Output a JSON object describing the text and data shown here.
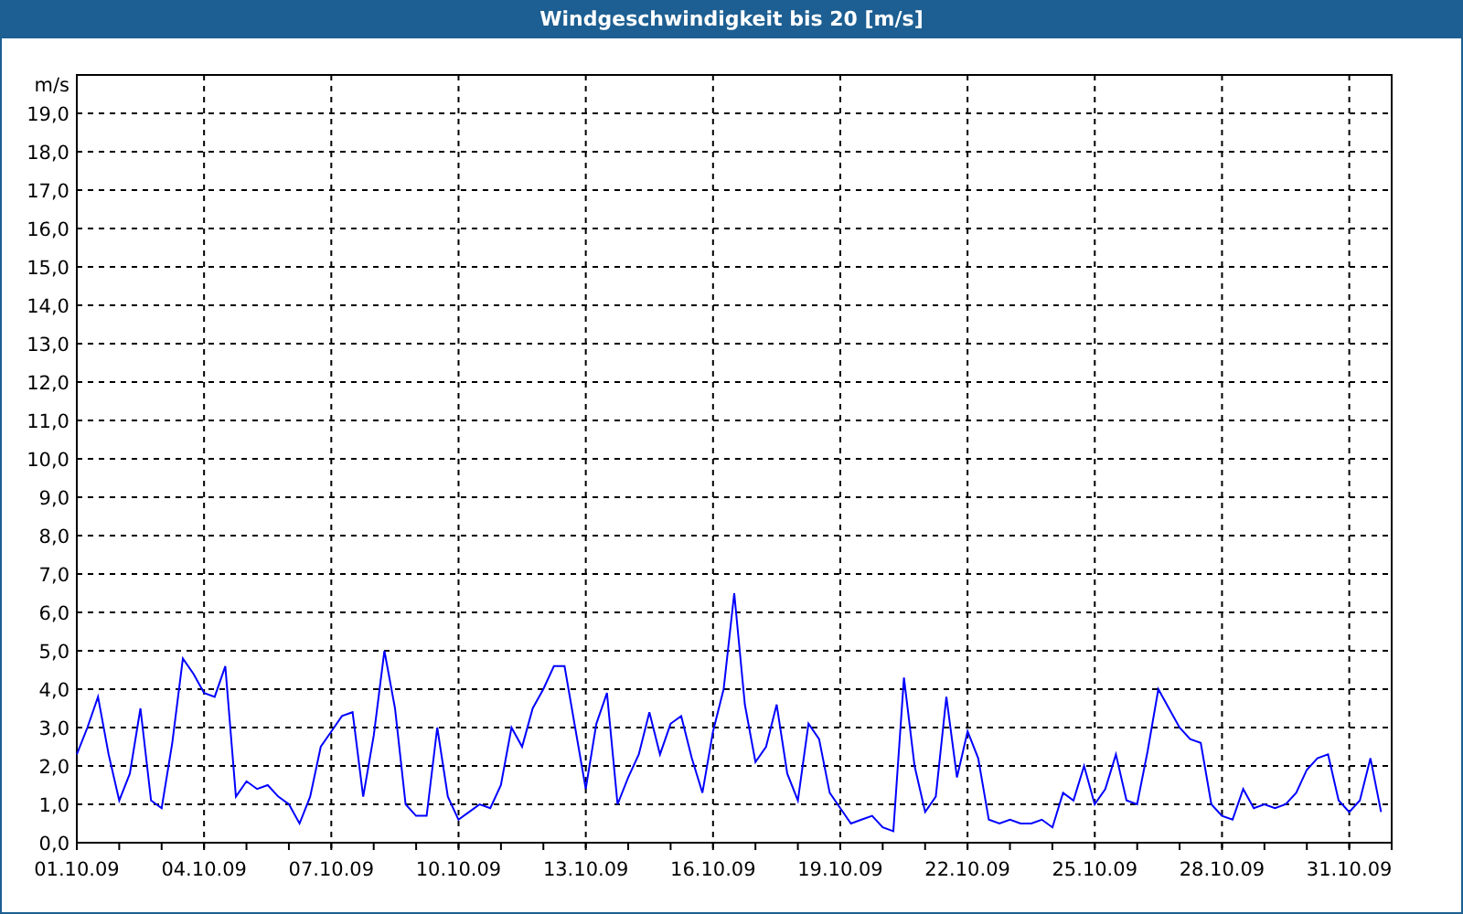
{
  "chart_data": {
    "type": "line",
    "grid": true,
    "title": "Windgeschwindigkeit bis 20 [m/s]",
    "ylabel": "m/s",
    "ylim": [
      0,
      20
    ],
    "yticks": [
      {
        "value": 0,
        "label": "0,0"
      },
      {
        "value": 1,
        "label": "1,0"
      },
      {
        "value": 2,
        "label": "2,0"
      },
      {
        "value": 3,
        "label": "3,0"
      },
      {
        "value": 4,
        "label": "4,0"
      },
      {
        "value": 5,
        "label": "5,0"
      },
      {
        "value": 6,
        "label": "6,0"
      },
      {
        "value": 7,
        "label": "7,0"
      },
      {
        "value": 8,
        "label": "8,0"
      },
      {
        "value": 9,
        "label": "9,0"
      },
      {
        "value": 10,
        "label": "10,0"
      },
      {
        "value": 11,
        "label": "11,0"
      },
      {
        "value": 12,
        "label": "12,0"
      },
      {
        "value": 13,
        "label": "13,0"
      },
      {
        "value": 14,
        "label": "14,0"
      },
      {
        "value": 15,
        "label": "15,0"
      },
      {
        "value": 16,
        "label": "16,0"
      },
      {
        "value": 17,
        "label": "17,0"
      },
      {
        "value": 18,
        "label": "18,0"
      },
      {
        "value": 19,
        "label": "19,0"
      }
    ],
    "categories": [
      "01.10.09",
      null,
      null,
      null,
      null,
      null,
      null,
      null,
      null,
      null,
      null,
      null,
      "04.10.09",
      null,
      null,
      null,
      null,
      null,
      null,
      null,
      null,
      null,
      null,
      null,
      "07.10.09",
      null,
      null,
      null,
      null,
      null,
      null,
      null,
      null,
      null,
      null,
      null,
      "10.10.09",
      null,
      null,
      null,
      null,
      null,
      null,
      null,
      null,
      null,
      null,
      null,
      "13.10.09",
      null,
      null,
      null,
      null,
      null,
      null,
      null,
      null,
      null,
      null,
      null,
      "16.10.09",
      null,
      null,
      null,
      null,
      null,
      null,
      null,
      null,
      null,
      null,
      null,
      "19.10.09",
      null,
      null,
      null,
      null,
      null,
      null,
      null,
      null,
      null,
      null,
      null,
      "22.10.09",
      null,
      null,
      null,
      null,
      null,
      null,
      null,
      null,
      null,
      null,
      null,
      "25.10.09",
      null,
      null,
      null,
      null,
      null,
      null,
      null,
      null,
      null,
      null,
      null,
      "28.10.09",
      null,
      null,
      null,
      null,
      null,
      null,
      null,
      null,
      null,
      null,
      null,
      "31.10.09",
      null,
      null,
      null
    ],
    "series": [
      {
        "color": "#0000ff",
        "values": [
          2.3,
          3.0,
          3.8,
          2.3,
          1.1,
          1.8,
          3.5,
          1.1,
          0.9,
          2.6,
          4.8,
          4.4,
          3.9,
          3.8,
          4.6,
          1.2,
          1.6,
          1.4,
          1.5,
          1.2,
          1.0,
          0.5,
          1.2,
          2.5,
          2.9,
          3.3,
          3.4,
          1.2,
          2.8,
          5.0,
          3.5,
          1.0,
          0.7,
          0.7,
          3.0,
          1.2,
          0.6,
          0.8,
          1.0,
          0.9,
          1.5,
          3.0,
          2.5,
          3.5,
          4.0,
          4.6,
          4.6,
          3.0,
          1.4,
          3.1,
          3.9,
          1.0,
          1.7,
          2.3,
          3.4,
          2.3,
          3.1,
          3.3,
          2.2,
          1.3,
          2.9,
          4.0,
          6.5,
          3.6,
          2.1,
          2.5,
          3.6,
          1.8,
          1.1,
          3.1,
          2.7,
          1.3,
          0.9,
          0.5,
          0.6,
          0.7,
          0.4,
          0.3,
          4.3,
          2.0,
          0.8,
          1.2,
          3.8,
          1.7,
          2.9,
          2.2,
          0.6,
          0.5,
          0.6,
          0.5,
          0.5,
          0.6,
          0.4,
          1.3,
          1.1,
          2.0,
          1.0,
          1.4,
          2.3,
          1.1,
          1.0,
          2.4,
          4.0,
          3.5,
          3.0,
          2.7,
          2.6,
          1.0,
          0.7,
          0.6,
          1.4,
          0.9,
          1.0,
          0.9,
          1.0,
          1.3,
          1.9,
          2.2,
          2.3,
          1.1,
          0.8,
          1.1,
          2.2,
          0.8
        ]
      }
    ]
  }
}
